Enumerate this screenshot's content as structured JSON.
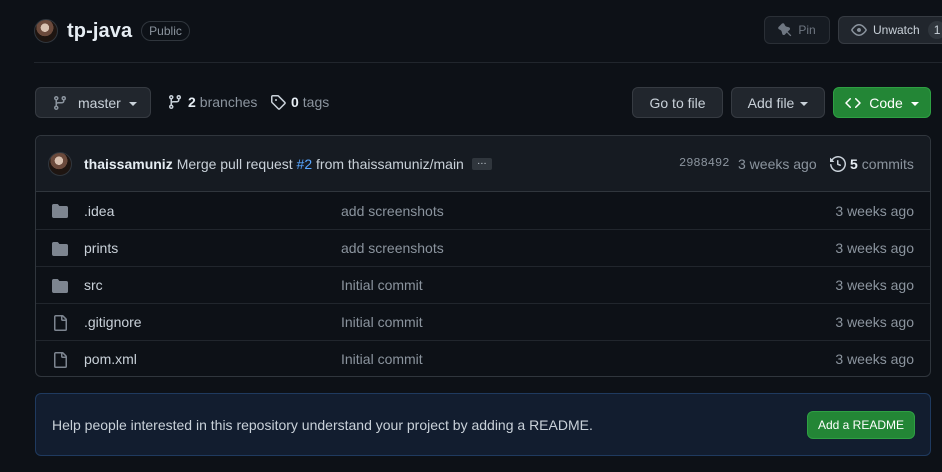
{
  "repo": {
    "name": "tp-java",
    "visibility": "Public",
    "pin_label": "Pin",
    "unwatch_label": "Unwatch",
    "watch_count": "1"
  },
  "branch_bar": {
    "current_branch": "master",
    "branches_count": "2",
    "branches_label": "branches",
    "tags_count": "0",
    "tags_label": "tags",
    "go_to_file": "Go to file",
    "add_file": "Add file",
    "code": "Code"
  },
  "commit": {
    "author": "thaissamuniz",
    "message_prefix": "Merge pull request",
    "pr_link": "#2",
    "message_suffix": "from thaissamuniz/main",
    "expand": "…",
    "sha": "2988492",
    "time": "3 weeks ago",
    "commits_count": "5",
    "commits_label": "commits"
  },
  "files": [
    {
      "name": ".idea",
      "type": "folder",
      "message": "add screenshots",
      "time": "3 weeks ago"
    },
    {
      "name": "prints",
      "type": "folder",
      "message": "add screenshots",
      "time": "3 weeks ago"
    },
    {
      "name": "src",
      "type": "folder",
      "message": "Initial commit",
      "time": "3 weeks ago"
    },
    {
      "name": ".gitignore",
      "type": "file",
      "message": "Initial commit",
      "time": "3 weeks ago"
    },
    {
      "name": "pom.xml",
      "type": "file",
      "message": "Initial commit",
      "time": "3 weeks ago"
    }
  ],
  "readme_banner": {
    "text": "Help people interested in this repository understand your project by adding a README.",
    "button": "Add a README"
  },
  "colors": {
    "background": "#0d1117",
    "accent_green": "#238636",
    "link_blue": "#58a6ff",
    "muted": "#8b949e"
  }
}
